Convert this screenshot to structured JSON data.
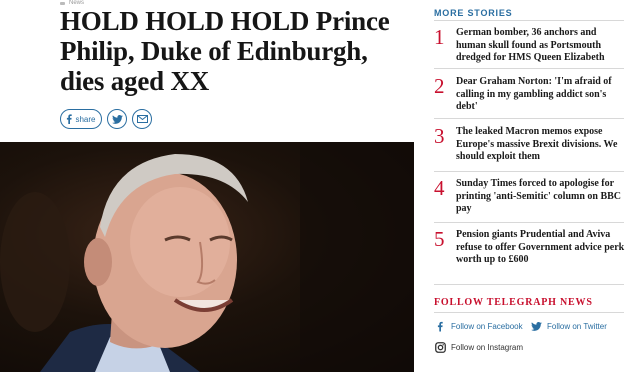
{
  "breadcrumb": {
    "label": "News"
  },
  "article": {
    "headline": "HOLD HOLD HOLD Prince Philip, Duke of Edinburgh, dies aged XX",
    "share_label": "share"
  },
  "sidebar": {
    "more_stories_title": "MORE STORIES",
    "stories": [
      {
        "number": "1",
        "text": "German bomber, 36 anchors and human skull found as Portsmouth dredged for HMS Queen Elizabeth"
      },
      {
        "number": "2",
        "text": "Dear Graham Norton: 'I'm afraid of calling in my gambling addict son's debt'"
      },
      {
        "number": "3",
        "text": "The leaked Macron memos expose Europe's massive Brexit divisions. We should exploit them"
      },
      {
        "number": "4",
        "text": "Sunday Times forced to apologise for printing 'anti-Semitic' column on BBC pay"
      },
      {
        "number": "5",
        "text": "Pension giants Prudential and Aviva refuse to offer Government advice perk worth up to £600"
      }
    ],
    "follow_title": "FOLLOW TELEGRAPH NEWS",
    "follow": {
      "facebook": "Follow on Facebook",
      "twitter": "Follow on Twitter",
      "instagram": "Follow on Instagram"
    }
  },
  "colors": {
    "accent_blue": "#2a6ea1",
    "accent_red": "#c8102e"
  }
}
